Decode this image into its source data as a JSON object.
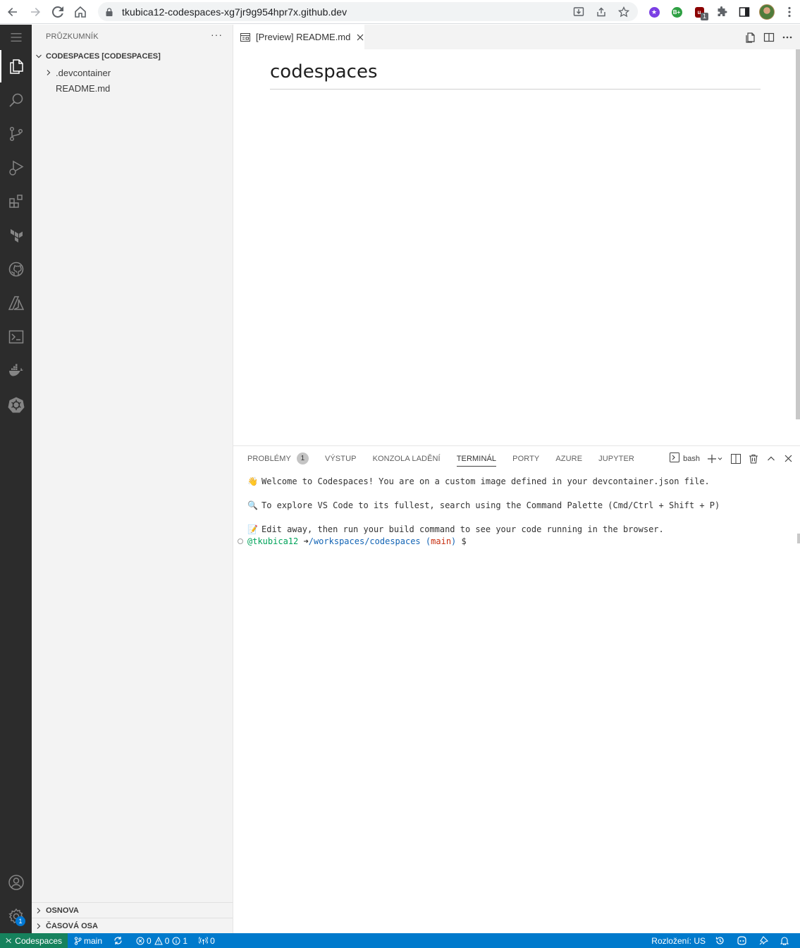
{
  "browser": {
    "url": "tkubica12-codespaces-xg7jr9g954hpr7x.github.dev",
    "extensions": [
      {
        "name": "purple-star-extension",
        "color": "#7b3fe4"
      },
      {
        "name": "green-b-extension",
        "color": "#2ea043",
        "text": "B+"
      },
      {
        "name": "ublock-extension",
        "color": "#8b0000",
        "badge": "1"
      }
    ]
  },
  "sidebar": {
    "title": "PRŮZKUMNÍK",
    "more": "···",
    "workspace": "CODESPACES [CODESPACES]",
    "items": [
      {
        "label": ".devcontainer",
        "type": "folder"
      },
      {
        "label": "README.md",
        "type": "file"
      }
    ],
    "outline": "OSNOVA",
    "timeline": "ČASOVÁ OSA"
  },
  "activity": {
    "settings_badge": "1"
  },
  "editor": {
    "tab_label": "[Preview] README.md",
    "heading": "codespaces"
  },
  "panel": {
    "tabs": [
      {
        "label": "PROBLÉMY",
        "badge": "1"
      },
      {
        "label": "VÝSTUP"
      },
      {
        "label": "KONZOLA LADĚNÍ"
      },
      {
        "label": "TERMINÁL",
        "active": true
      },
      {
        "label": "PORTY"
      },
      {
        "label": "AZURE"
      },
      {
        "label": "JUPYTER"
      }
    ],
    "shell": "bash"
  },
  "terminal": {
    "line1_emoji": "👋",
    "line1": "Welcome to Codespaces! You are on a custom image defined in your devcontainer.json file.",
    "line2_emoji": "🔍",
    "line2": "To explore VS Code to its fullest, search using the Command Palette (Cmd/Ctrl + Shift + P)",
    "line3_emoji": "📝",
    "line3": "Edit away, then run your build command to see your code running in the browser.",
    "prompt_user": "@tkubica12",
    "prompt_arrow": "➜",
    "prompt_path": "/workspaces/codespaces",
    "prompt_branch_open": "(",
    "prompt_branch": "main",
    "prompt_branch_close": ")",
    "prompt_symbol": "$"
  },
  "status": {
    "remote": "Codespaces",
    "branch": "main",
    "errors": "0",
    "warnings": "0",
    "infos": "1",
    "ports": "0",
    "layout": "Rozložení: US"
  }
}
